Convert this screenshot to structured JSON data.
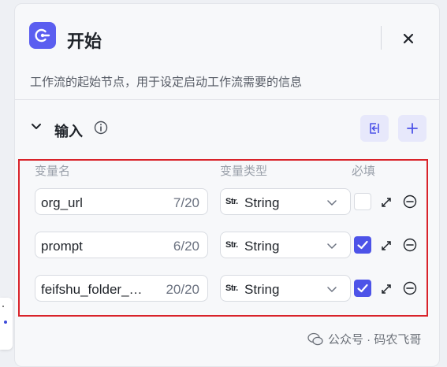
{
  "header": {
    "title": "开始",
    "description": "工作流的起始节点，用于设定启动工作流需要的信息"
  },
  "inputs_section": {
    "label": "输入",
    "columns": {
      "name": "变量名",
      "type": "变量类型",
      "required": "必填"
    },
    "rows": [
      {
        "name": "org_url",
        "count": "7/20",
        "type_icon": "Str.",
        "type": "String",
        "required": false
      },
      {
        "name": "prompt",
        "count": "6/20",
        "type_icon": "Str.",
        "type": "String",
        "required": true
      },
      {
        "name": "feifshu_folder_…",
        "count": "20/20",
        "type_icon": "Str.",
        "type": "String",
        "required": true
      }
    ]
  },
  "watermark": {
    "text": "公众号 · 码农飞哥"
  },
  "colors": {
    "accent": "#4d53e8",
    "highlight_border": "#d9232a",
    "panel_bg": "#f7f8fa"
  }
}
